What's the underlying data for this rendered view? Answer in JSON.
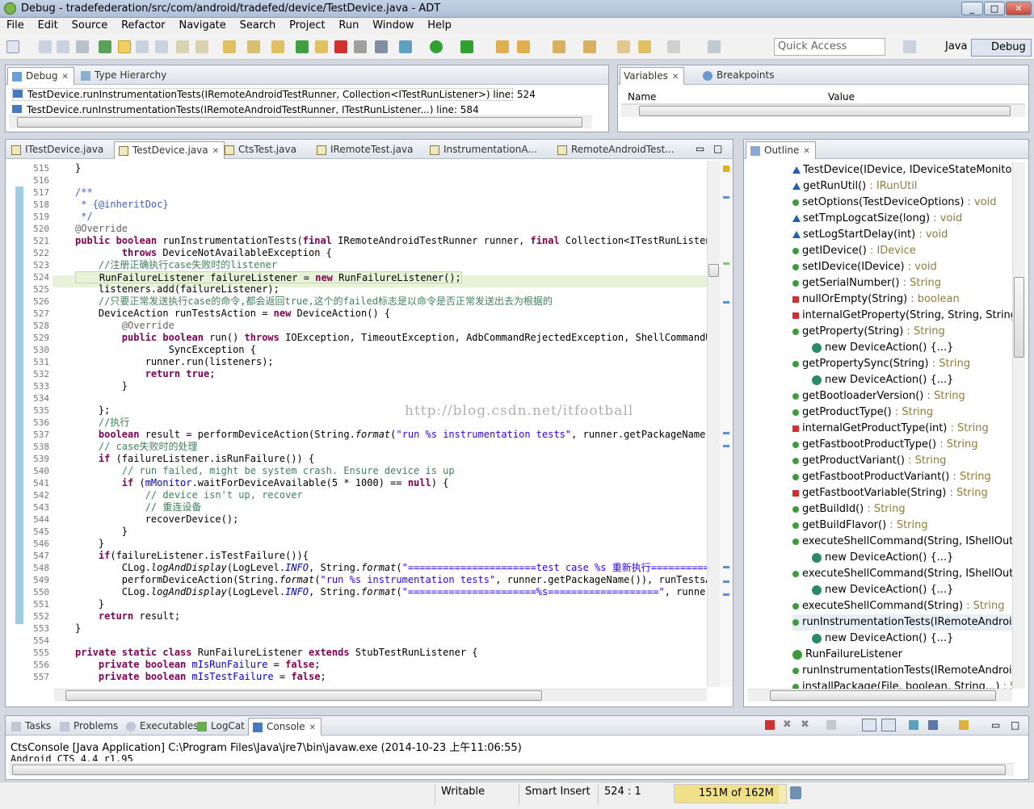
{
  "window": {
    "title": "Debug - tradefederation/src/com/android/tradefed/device/TestDevice.java - ADT"
  },
  "menu": [
    "File",
    "Edit",
    "Source",
    "Refactor",
    "Navigate",
    "Search",
    "Project",
    "Run",
    "Window",
    "Help"
  ],
  "toolbar": {
    "quick_access_placeholder": "Quick Access",
    "perspectives": [
      "Java",
      "Debug"
    ]
  },
  "debug_view": {
    "tabs": [
      "Debug",
      "Type Hierarchy"
    ],
    "frames": [
      "TestDevice.runInstrumentationTests(IRemoteAndroidTestRunner, Collection<ITestRunListener>) line: 524",
      "TestDevice.runInstrumentationTests(IRemoteAndroidTestRunner, ITestRunListener...) line: 584"
    ]
  },
  "variables_view": {
    "tabs": [
      "Variables",
      "Breakpoints"
    ],
    "columns": [
      "Name",
      "Value"
    ]
  },
  "editor": {
    "tabs": [
      "ITestDevice.java",
      "TestDevice.java",
      "CtsTest.java",
      "IRemoteTest.java",
      "InstrumentationA...",
      "RemoteAndroidTest..."
    ],
    "watermark": "http://blog.csdn.net/itfootball",
    "line_numbers": [
      "515",
      "516",
      "517",
      "518",
      "519",
      "520",
      "521",
      "522",
      "523",
      "524",
      "525",
      "526",
      "527",
      "528",
      "529",
      "530",
      "531",
      "532",
      "533",
      "534",
      "535",
      "536",
      "537",
      "538",
      "539",
      "540",
      "541",
      "542",
      "543",
      "544",
      "545",
      "546",
      "547",
      "548",
      "549",
      "550",
      "551",
      "552",
      "553",
      "554",
      "555",
      "556",
      "557"
    ]
  },
  "outline": {
    "tab": "Outline",
    "items": [
      {
        "n": "TestDevice(IDevice, IDeviceStateMonitor)",
        "r": "",
        "k": "tri"
      },
      {
        "n": "getRunUtil()",
        "r": " : IRunUtil",
        "k": "tri"
      },
      {
        "n": "setOptions(TestDeviceOptions)",
        "r": " : void",
        "k": "dot"
      },
      {
        "n": "setTmpLogcatSize(long)",
        "r": " : void",
        "k": "tri"
      },
      {
        "n": "setLogStartDelay(int)",
        "r": " : void",
        "k": "tri"
      },
      {
        "n": "getIDevice()",
        "r": " : IDevice",
        "k": "dot"
      },
      {
        "n": "setIDevice(IDevice)",
        "r": " : void",
        "k": "dot"
      },
      {
        "n": "getSerialNumber()",
        "r": " : String",
        "k": "dot"
      },
      {
        "n": "nullOrEmpty(String)",
        "r": " : boolean",
        "k": "sq"
      },
      {
        "n": "internalGetProperty(String, String, String)",
        "r": " :",
        "k": "sq"
      },
      {
        "n": "getProperty(String)",
        "r": " : String",
        "k": "dot"
      },
      {
        "n": "new DeviceAction() {...}",
        "r": "",
        "k": "anon"
      },
      {
        "n": "getPropertySync(String)",
        "r": " : String",
        "k": "dot"
      },
      {
        "n": "new DeviceAction() {...}",
        "r": "",
        "k": "anon"
      },
      {
        "n": "getBootloaderVersion()",
        "r": " : String",
        "k": "dot"
      },
      {
        "n": "getProductType()",
        "r": " : String",
        "k": "dot"
      },
      {
        "n": "internalGetProductType(int)",
        "r": " : String",
        "k": "sq"
      },
      {
        "n": "getFastbootProductType()",
        "r": " : String",
        "k": "dot"
      },
      {
        "n": "getProductVariant()",
        "r": " : String",
        "k": "dot"
      },
      {
        "n": "getFastbootProductVariant()",
        "r": " : String",
        "k": "dot"
      },
      {
        "n": "getFastbootVariable(String)",
        "r": " : String",
        "k": "sq"
      },
      {
        "n": "getBuildId()",
        "r": " : String",
        "k": "dot"
      },
      {
        "n": "getBuildFlavor()",
        "r": " : String",
        "k": "dot"
      },
      {
        "n": "executeShellCommand(String, IShellOutpu",
        "r": "",
        "k": "dot"
      },
      {
        "n": "new DeviceAction() {...}",
        "r": "",
        "k": "anon"
      },
      {
        "n": "executeShellCommand(String, IShellOutpu",
        "r": "",
        "k": "dot"
      },
      {
        "n": "new DeviceAction() {...}",
        "r": "",
        "k": "anon"
      },
      {
        "n": "executeShellCommand(String)",
        "r": " : String",
        "k": "dot"
      },
      {
        "n": "runInstrumentationTests(IRemoteAndroidT",
        "r": "",
        "k": "dot"
      },
      {
        "n": "new DeviceAction() {...}",
        "r": "",
        "k": "anon"
      },
      {
        "n": "RunFailureListener",
        "r": "",
        "k": "cls"
      },
      {
        "n": "runInstrumentationTests(IRemoteAndroidT",
        "r": "",
        "k": "dot"
      },
      {
        "n": "installPackage(File, boolean, String...)",
        "r": " : Stri",
        "k": "dot"
      }
    ]
  },
  "console": {
    "tabs": [
      "Tasks",
      "Problems",
      "Executables",
      "LogCat",
      "Console"
    ],
    "header": "CtsConsole [Java Application] C:\\Program Files\\Java\\jre7\\bin\\javaw.exe (2014-10-23 上午11:06:55)",
    "line1": "Android CTS 4.4_r1.95"
  },
  "status": {
    "writable": "Writable",
    "insert": "Smart Insert",
    "position": "524 : 1",
    "heap": "151M of 162M"
  }
}
